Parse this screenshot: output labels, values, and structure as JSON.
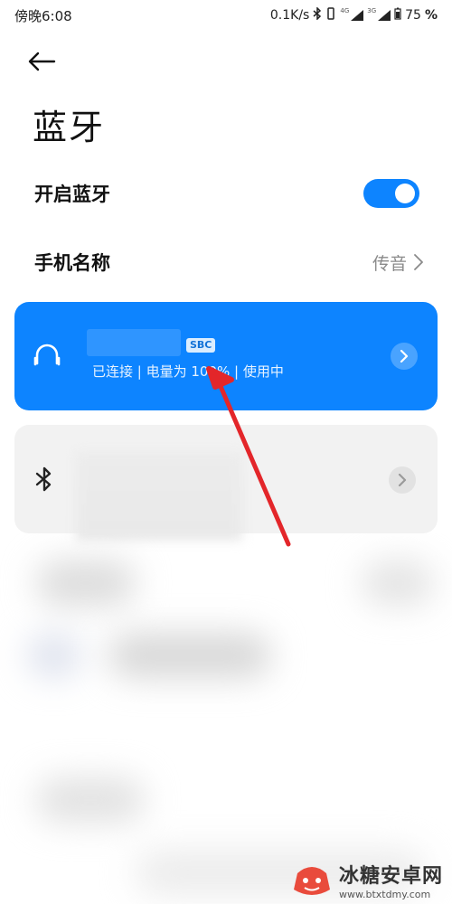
{
  "status_bar": {
    "time": "傍晚6:08",
    "speed": "0.1K/s",
    "net_type_1": "4G",
    "net_type_2": "3G",
    "battery": "75",
    "battery_unit": "%"
  },
  "page": {
    "title": "蓝牙"
  },
  "settings": {
    "enable_label": "开启蓝牙",
    "enable_state": "on",
    "phone_name_label": "手机名称",
    "phone_name_value": "传音"
  },
  "connected_device": {
    "codec": "SBC",
    "status": "已连接 | 电量为 100% | 使用中"
  },
  "watermark": {
    "title": "冰糖安卓网",
    "url": "www.btxtdmy.com"
  },
  "colors": {
    "accent": "#0d84ff",
    "annotation": "#e3262a"
  }
}
